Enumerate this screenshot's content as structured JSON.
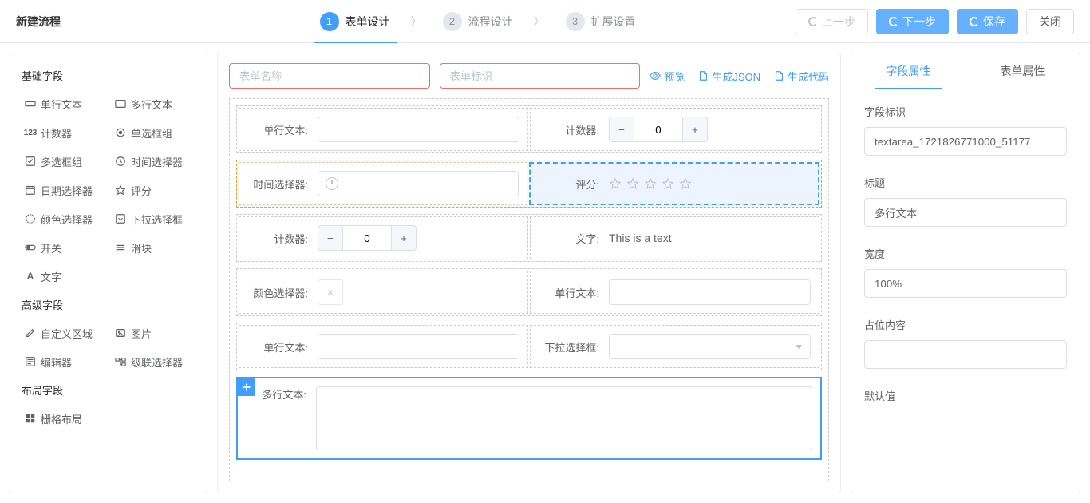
{
  "header": {
    "title": "新建流程",
    "steps": [
      {
        "num": "1",
        "label": "表单设计",
        "active": true
      },
      {
        "num": "2",
        "label": "流程设计",
        "active": false
      },
      {
        "num": "3",
        "label": "扩展设置",
        "active": false
      }
    ],
    "actions": {
      "prev": "上一步",
      "next": "下一步",
      "save": "保存",
      "close": "关闭"
    }
  },
  "left": {
    "cat_basic": "基础字段",
    "basic": [
      {
        "icon": "single-line",
        "label": "单行文本"
      },
      {
        "icon": "multi-line",
        "label": "多行文本"
      },
      {
        "icon": "counter",
        "label": "计数器"
      },
      {
        "icon": "radio",
        "label": "单选框组"
      },
      {
        "icon": "checkbox",
        "label": "多选框组"
      },
      {
        "icon": "time",
        "label": "时间选择器"
      },
      {
        "icon": "date",
        "label": "日期选择器"
      },
      {
        "icon": "rate",
        "label": "评分"
      },
      {
        "icon": "color",
        "label": "颜色选择器"
      },
      {
        "icon": "select",
        "label": "下拉选择框"
      },
      {
        "icon": "switch",
        "label": "开关"
      },
      {
        "icon": "slider",
        "label": "滑块"
      },
      {
        "icon": "text",
        "label": "文字"
      }
    ],
    "cat_advanced": "高级字段",
    "advanced": [
      {
        "icon": "custom",
        "label": "自定义区域"
      },
      {
        "icon": "image",
        "label": "图片"
      },
      {
        "icon": "editor",
        "label": "编辑器"
      },
      {
        "icon": "cascader",
        "label": "级联选择器"
      }
    ],
    "cat_layout": "布局字段",
    "layout": [
      {
        "icon": "grid",
        "label": "栅格布局"
      }
    ]
  },
  "center": {
    "form_name_placeholder": "表单名称",
    "form_key_placeholder": "表单标识",
    "actions": {
      "preview": "预览",
      "gen_json": "生成JSON",
      "gen_code": "生成代码"
    },
    "counter_default": "0",
    "rows": {
      "r1_singletext": "单行文本:",
      "r1_counter": "计数器:",
      "r2_time": "时间选择器:",
      "r2_rate": "评分:",
      "r3_counter": "计数器:",
      "r3_text": "文字:",
      "r3_text_val": "This is a text",
      "r4_color": "颜色选择器:",
      "r4_singletext": "单行文本:",
      "r5_singletext": "单行文本:",
      "r5_select": "下拉选择框:",
      "r6_textarea": "多行文本:"
    }
  },
  "right": {
    "tab_field": "字段属性",
    "tab_form": "表单属性",
    "props": {
      "key_label": "字段标识",
      "key_value": "textarea_1721826771000_51177",
      "title_label": "标题",
      "title_value": "多行文本",
      "width_label": "宽度",
      "width_value": "100%",
      "placeholder_label": "占位内容",
      "placeholder_value": "",
      "default_label": "默认值"
    }
  }
}
